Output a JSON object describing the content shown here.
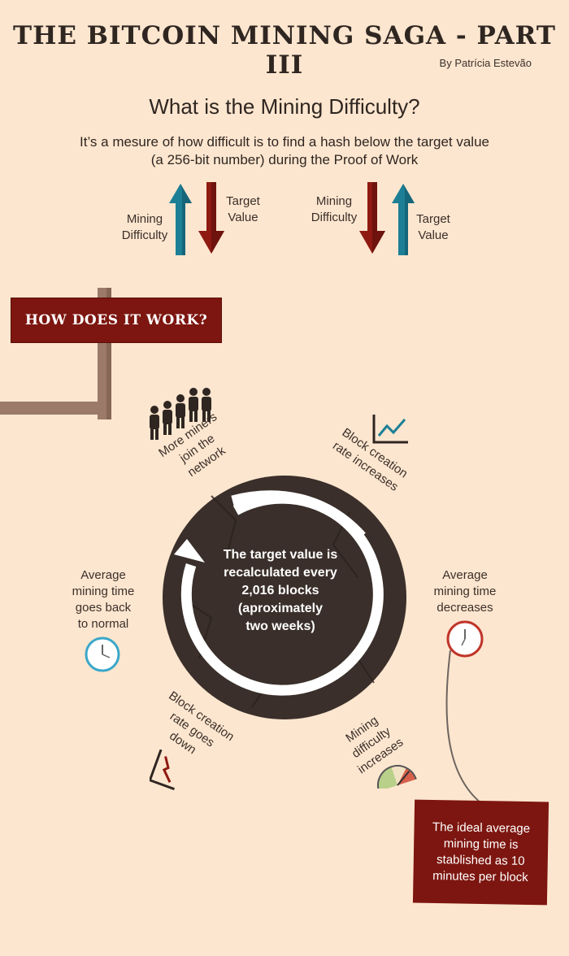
{
  "header": {
    "title": "THE BITCOIN MINING SAGA - PART III",
    "author": "By Patrícia Estevão"
  },
  "intro": {
    "question": "What is the Mining Difficulty?",
    "definition_line1": "It’s a mesure of how difficult is to find a hash below the target value",
    "definition_line2": "(a 256-bit number) during the Proof of Work"
  },
  "relation_left": {
    "difficulty_line1": "Mining",
    "difficulty_line2": "Difficulty",
    "target_line1": "Target",
    "target_line2": "Value"
  },
  "relation_right": {
    "difficulty_line1": "Mining",
    "difficulty_line2": "Difficulty",
    "target_line1": "Target",
    "target_line2": "Value"
  },
  "section": {
    "banner": "HOW DOES IT WORK?"
  },
  "cycle": {
    "center_lines": [
      "The target value is",
      "recalculated every",
      "2,016 blocks",
      "(aproximately",
      "two weeks)"
    ],
    "step_more_miners": [
      "More miners",
      "join the",
      "network"
    ],
    "step_rate_increases": [
      "Block creation",
      "rate increases"
    ],
    "step_time_decreases": [
      "Average",
      "mining time",
      "decreases"
    ],
    "step_difficulty_increases": [
      "Mining",
      "difficulty",
      "increases"
    ],
    "step_rate_down": [
      "Block creation",
      "rate goes",
      "down"
    ],
    "step_time_normal": [
      "Average",
      "mining time",
      "goes back",
      "to normal"
    ]
  },
  "note": {
    "ideal_time": "The ideal average mining time is stablished as 10 minutes per block"
  },
  "colors": {
    "background": "#fde6cf",
    "arrow_teal": "#1c7f96",
    "arrow_red": "#8e1a12",
    "banner_red": "#7d1610",
    "circle_dark": "#3a2f2a",
    "signpost": "#9c7a6a"
  },
  "icons": [
    "up-arrow-icon",
    "down-arrow-icon",
    "people-icon",
    "rising-chart-icon",
    "falling-chart-icon",
    "clock-icon",
    "gauge-icon",
    "cycle-arrow-icon",
    "pin-icon"
  ]
}
